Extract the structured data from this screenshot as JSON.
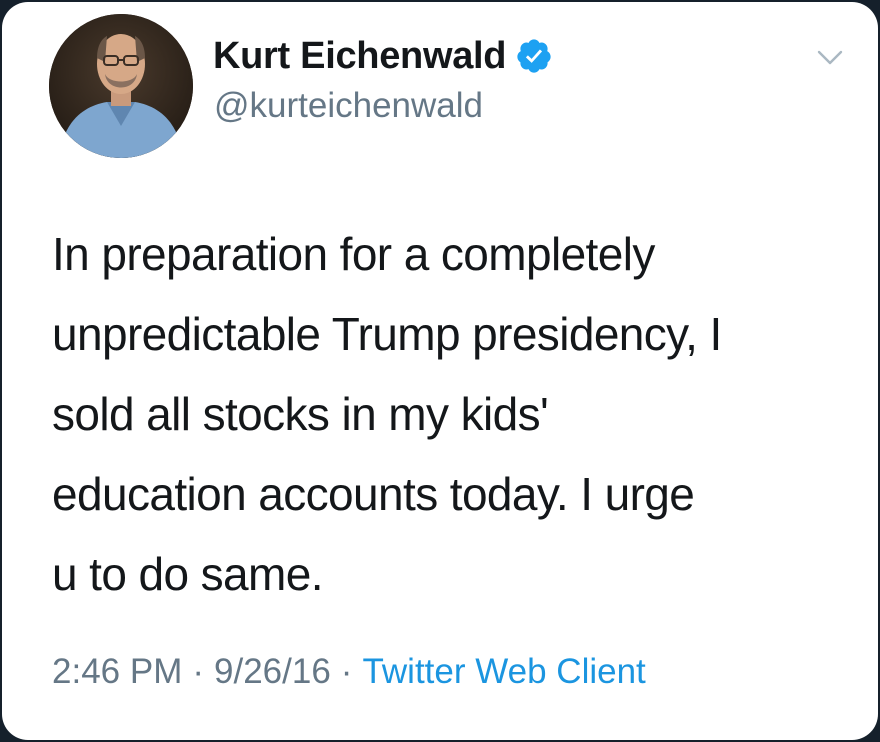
{
  "tweet": {
    "author": {
      "display_name": "Kurt Eichenwald",
      "handle": "@kurteichenwald",
      "verified": true,
      "avatar_icon": "author-avatar-photo"
    },
    "text": "In preparation for a completely\nunpredictable Trump presidency, I\nsold all stocks in my kids'\neducation accounts today. I urge\nu to do same.",
    "meta": {
      "time": "2:46 PM",
      "separator": "·",
      "date": "9/26/16",
      "source": "Twitter Web Client"
    },
    "menu_icon": "chevron-down-icon"
  },
  "colors": {
    "background": "#15202b",
    "card": "#ffffff",
    "text_primary": "#14171a",
    "text_secondary": "#657786",
    "link": "#1b95e0",
    "verified_badge": "#1da1f2"
  }
}
